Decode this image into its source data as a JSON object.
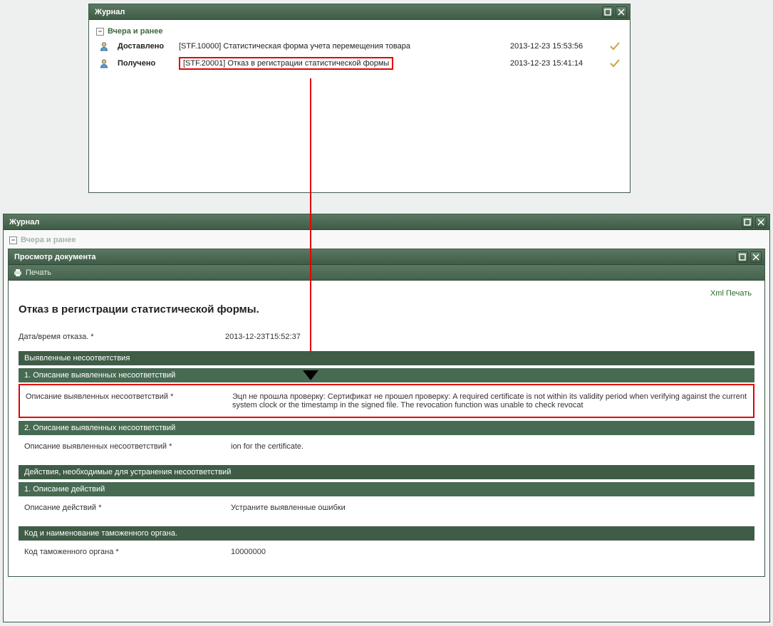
{
  "topPanel": {
    "title": "Журнал",
    "groupLabel": "Вчера и ранее",
    "rows": [
      {
        "status": "Доставлено",
        "subject": "[STF.10000] Статистическая форма учета перемещения товара",
        "date": "2013-12-23 15:53:56"
      },
      {
        "status": "Получено",
        "subject": "[STF.20001] Отказ в регистрации статистической формы",
        "date": "2013-12-23 15:41:14"
      }
    ]
  },
  "bottomPanel": {
    "title": "Журнал",
    "groupLabel": "Вчера и ранее",
    "docViewer": {
      "title": "Просмотр документа",
      "printLabel": "Печать",
      "xmlPrintLabel": "Xml Печать",
      "heading": "Отказ в регистрации статистической формы.",
      "dateLabel": "Дата/время отказа. *",
      "dateValue": "2013-12-23T15:52:37",
      "section1": "Выявленные несоответствия",
      "sub1": "1. Описание выявленных несоответствий",
      "fld1Label": "Описание выявленных несоответствий *",
      "fld1Value": "Эцп не прошла проверку: Сертификат не прошел проверку: A required certificate is not within its validity period when verifying against the current system clock or the timestamp in the signed file. The revocation function was unable to check revocat",
      "sub2": "2. Описание выявленных несоответствий",
      "fld2Label": "Описание выявленных несоответствий *",
      "fld2Value": "ion for the certificate.",
      "section2": "Действия, необходимые для устранения несоответствий",
      "sub3": "1. Описание действий",
      "fld3Label": "Описание действий *",
      "fld3Value": "Устраните выявленные ошибки",
      "section3": "Код и наименование таможенного органа.",
      "fld4Label": "Код таможенного органа *",
      "fld4Value": "10000000"
    }
  }
}
